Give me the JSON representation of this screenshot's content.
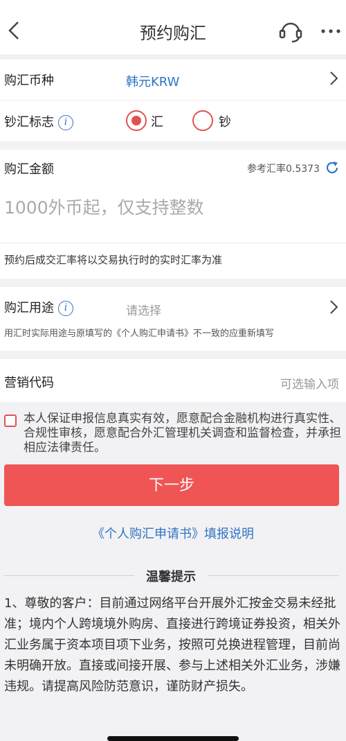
{
  "header": {
    "title": "预约购汇"
  },
  "currency": {
    "label": "购汇币种",
    "value": "韩元KRW"
  },
  "cash_flag": {
    "label": "钞汇标志",
    "options": [
      "汇",
      "钞"
    ],
    "selected": "汇"
  },
  "amount": {
    "label": "购汇金额",
    "rate_label": "参考汇率0.5373",
    "placeholder": "1000外币起，仅支持整数",
    "note": "预约后成交汇率将以交易执行时的实时汇率为准"
  },
  "purpose": {
    "label": "购汇用途",
    "placeholder": "请选择",
    "note": "用汇时实际用途与原填写的《个人购汇申请书》不一致的应重新填写"
  },
  "marketing": {
    "label": "营销代码",
    "placeholder": "可选输入项"
  },
  "declaration": {
    "text": "本人保证申报信息真实有效，愿意配合金融机构进行真实性、合规性审核，愿意配合外汇管理机关调查和监督检查，并承担相应法律责任。"
  },
  "actions": {
    "next_label": "下一步",
    "guide_link": "《个人购汇申请书》填报说明"
  },
  "tips": {
    "title": "温馨提示",
    "body": "1、尊敬的客户：目前通过网络平台开展外汇按金交易未经批准；境内个人跨境境外购房、直接进行跨境证券投资，相关外汇业务属于资本项目项下业务，按照可兑换进程管理，目前尚未明确开放。直接或间接开展、参与上述相关外汇业务，涉嫌违规。请提高风险防范意识，谨防财产损失。"
  },
  "colors": {
    "accent": "#ef5555",
    "link": "#2f74c4"
  }
}
